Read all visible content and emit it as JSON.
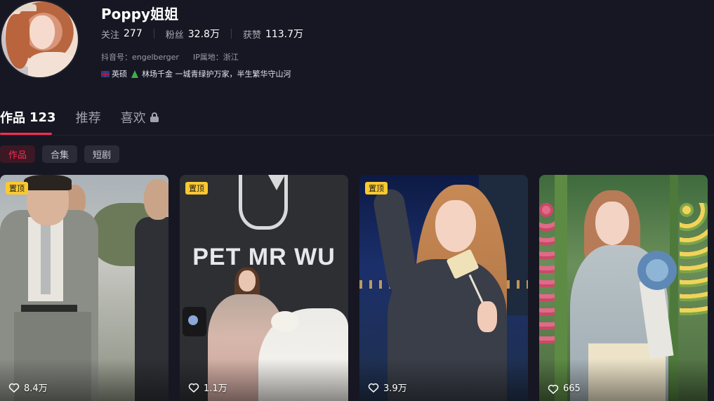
{
  "profile": {
    "name": "Poppy姐姐",
    "stats": [
      {
        "label": "关注",
        "value": "277"
      },
      {
        "label": "粉丝",
        "value": "32.8万"
      },
      {
        "label": "获赞",
        "value": "113.7万"
      }
    ],
    "douyin_id": "抖音号：engelberger",
    "ip_location": "IP属地：浙江",
    "bio_part1": "英硕",
    "bio_part2": "林场千金 一城青绿护万家，半生繁华守山河"
  },
  "tabs": [
    {
      "label": "作品",
      "count": "123",
      "active": true
    },
    {
      "label": "推荐"
    },
    {
      "label": "喜欢",
      "locked": true
    }
  ],
  "chips": [
    {
      "label": "作品",
      "active": true
    },
    {
      "label": "合集"
    },
    {
      "label": "短剧"
    }
  ],
  "videos": [
    {
      "pinned": true,
      "pin_label": "置顶",
      "likes": "8.4万"
    },
    {
      "pinned": true,
      "pin_label": "置顶",
      "likes": "1.1万",
      "overlay_text": "PET MR WU"
    },
    {
      "pinned": true,
      "pin_label": "置顶",
      "likes": "3.9万"
    },
    {
      "pinned": false,
      "likes": "665"
    }
  ],
  "colors": {
    "background": "#161722",
    "accent": "#fe2c55",
    "pin_badge": "#fac92f"
  }
}
